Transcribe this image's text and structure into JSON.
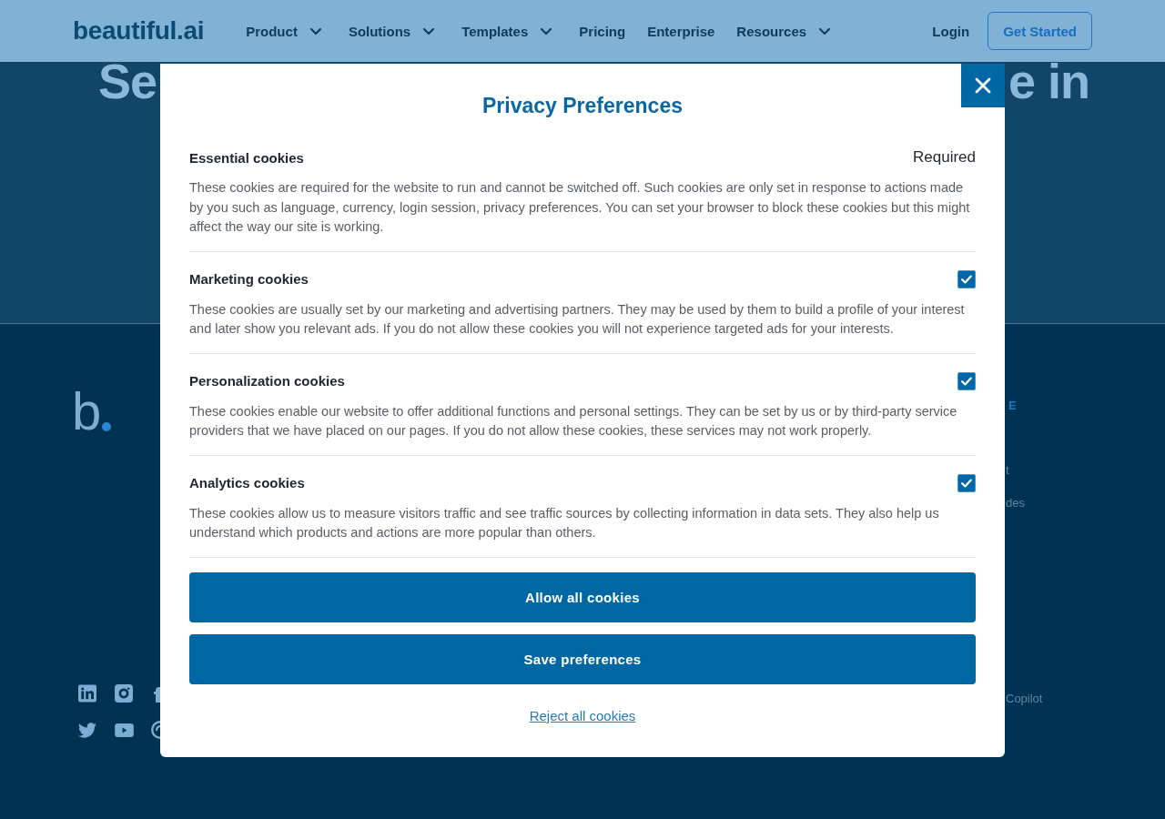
{
  "header": {
    "logo": "beautiful.ai",
    "nav": [
      {
        "label": "Product",
        "has_menu": true
      },
      {
        "label": "Solutions",
        "has_menu": true
      },
      {
        "label": "Templates",
        "has_menu": true
      },
      {
        "label": "Pricing",
        "has_menu": false
      },
      {
        "label": "Enterprise",
        "has_menu": false
      },
      {
        "label": "Resources",
        "has_menu": true
      }
    ],
    "login": "Login",
    "cta": "Get Started"
  },
  "hero": {
    "heading_fragments": [
      "Se",
      "e in"
    ]
  },
  "footer": {
    "logo": "b",
    "column_2": {
      "heading": "E",
      "links": [
        "t",
        "des",
        "Copilot"
      ]
    }
  },
  "privacy_modal": {
    "title": "Privacy Preferences",
    "sections": [
      {
        "title": "Essential cookies",
        "kind": "required",
        "status": "Required",
        "description": "These cookies are required for the website to run and cannot be switched off. Such cookies are only set in response to actions made by you such as language, currency, login session, privacy preferences. You can set your browser to block these cookies but this might affect the way our site is working."
      },
      {
        "title": "Marketing cookies",
        "kind": "checkbox",
        "checked": true,
        "description": "These cookies are usually set by our marketing and advertising partners. They may be used by them to build a profile of your interest and later show you relevant ads. If you do not allow these cookies you will not experience targeted ads for your interests."
      },
      {
        "title": "Personalization cookies",
        "kind": "checkbox",
        "checked": true,
        "description": "These cookies enable our website to offer additional functions and personal settings. They can be set by us or by third-party service providers that we have placed on our pages. If you do not allow these cookies, these services may not work properly."
      },
      {
        "title": "Analytics cookies",
        "kind": "checkbox",
        "checked": true,
        "description": "These cookies allow us to measure visitors traffic and see traffic sources by collecting information in data sets. They also help us understand which products and actions are more popular than others."
      }
    ],
    "buttons": [
      {
        "label": "Allow all cookies",
        "kind": "primary"
      },
      {
        "label": "Save preferences",
        "kind": "primary"
      },
      {
        "label": "Reject all cookies",
        "kind": "link"
      }
    ]
  }
}
